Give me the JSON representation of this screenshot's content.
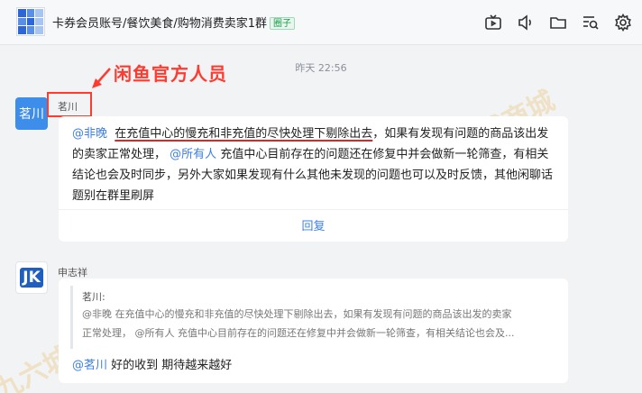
{
  "header": {
    "group_title": "卡券会员账号/餐饮美食/购物消费卖家1群",
    "group_badge": "圈子",
    "toolbar": [
      "tv-icon",
      "speaker-icon",
      "folder-icon",
      "search-list-icon",
      "gear-icon"
    ]
  },
  "annotation": {
    "label": "闲鱼官方人员",
    "color": "#ff3b30"
  },
  "timestamp": "昨天 22:56",
  "message_1": {
    "avatar_text": "茗川",
    "sender": "茗川",
    "mention_1": "@非晚",
    "text_underlined": "在充值中心的慢充和非充值的尽快处理下剔除出去",
    "text_1": "，如果有发现有问题的商品该出发的卖家正常处理，",
    "mention_2": "@所有人",
    "text_2": "充值中心目前存在的问题还在修复中并会做新一轮筛查，有相关结论也会及时同步，另外大家如果发现有什么其他未发现的问题也可以及时反馈，其他闲聊话题别在群里刷屏",
    "reply_label": "回复"
  },
  "message_2": {
    "avatar_text": "JK",
    "sender": "申志祥",
    "quote_author": "茗川:",
    "quote_line_1": "@非晚  在充值中心的慢充和非充值的尽快处理下剔除出去，如果有发现有问题的商品该出发的卖家",
    "quote_line_2": "正常处理，  @所有人 充值中心目前存在的问题还在修复中并会做新一轮筛查，有相关结论也会及...",
    "reply_mention": "@茗川",
    "reply_text": "好的收到 期待越来越好"
  },
  "watermarks": [
    "九六城商城",
    "九六城商城",
    "九六城"
  ]
}
